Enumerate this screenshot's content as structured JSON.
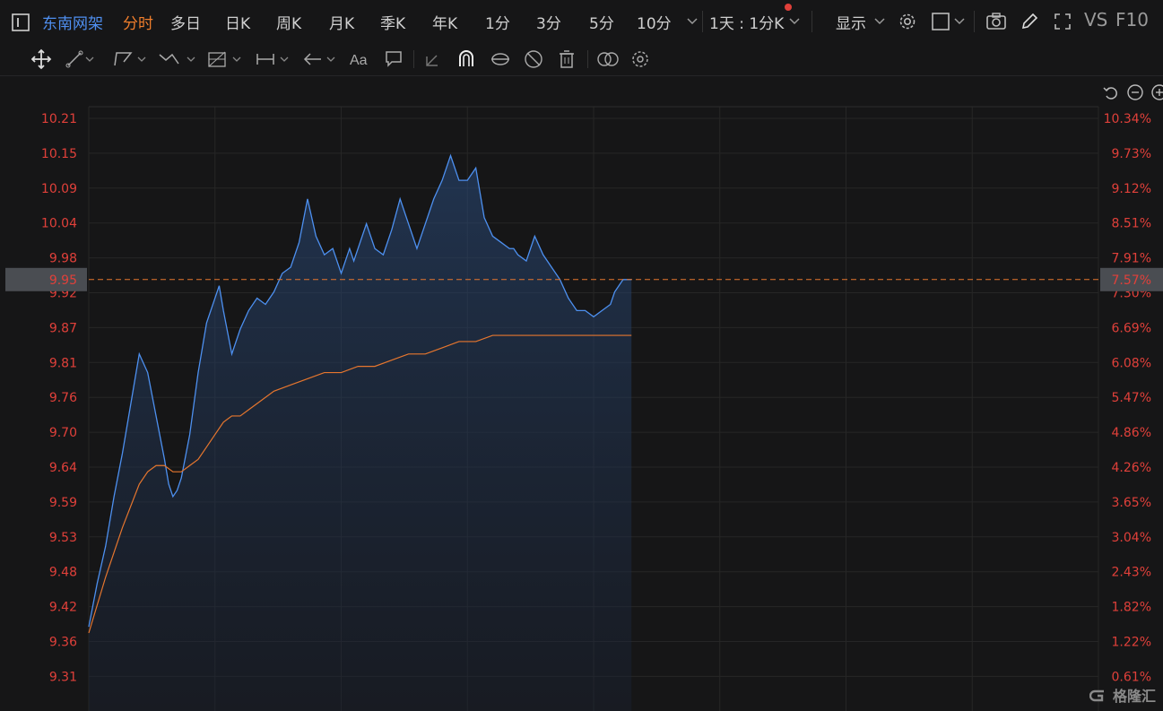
{
  "header": {
    "stock_name": "东南网架",
    "tabs": [
      {
        "label": "分时",
        "active": true
      },
      {
        "label": "多日"
      },
      {
        "label": "日K"
      },
      {
        "label": "周K"
      },
      {
        "label": "月K"
      },
      {
        "label": "季K"
      },
      {
        "label": "年K"
      },
      {
        "label": "1分"
      },
      {
        "label": "3分"
      },
      {
        "label": "5分"
      },
      {
        "label": "10分"
      }
    ],
    "period_select": "1天 : 1分K",
    "display_label": "显示",
    "vs_label": "VS",
    "f10_label": "F10"
  },
  "colors": {
    "price_line": "#4d90f0",
    "avg_line": "#e6762e",
    "axis_text": "#e0403a",
    "grid": "#262626",
    "crosshair": "#e6762e",
    "active_tab": "#f07e2c"
  },
  "chart_data": {
    "type": "line",
    "left_ticks": [
      "10.21",
      "10.15",
      "10.09",
      "10.04",
      "9.98",
      "9.92",
      "9.87",
      "9.81",
      "9.76",
      "9.70",
      "9.64",
      "9.59",
      "9.53",
      "9.48",
      "9.42",
      "9.36",
      "9.31"
    ],
    "right_ticks": [
      "10.34%",
      "9.73%",
      "9.12%",
      "8.51%",
      "7.91%",
      "7.30%",
      "6.69%",
      "6.08%",
      "5.47%",
      "4.86%",
      "4.26%",
      "3.65%",
      "3.04%",
      "2.43%",
      "1.82%",
      "1.22%",
      "0.61%"
    ],
    "crosshair_price": "9.95",
    "crosshair_pct": "7.57%",
    "ylim": [
      9.31,
      10.21
    ],
    "x_sessions": 240,
    "series": [
      {
        "key": "price",
        "x": [
          0,
          2,
          4,
          6,
          8,
          10,
          12,
          14,
          16,
          18,
          19,
          20,
          21,
          22,
          24,
          26,
          28,
          30,
          31,
          32,
          34,
          36,
          38,
          40,
          42,
          44,
          46,
          48,
          50,
          52,
          54,
          56,
          58,
          60,
          62,
          63,
          64,
          66,
          68,
          70,
          72,
          74,
          76,
          78,
          80,
          82,
          84,
          86,
          88,
          90,
          92,
          94,
          96,
          98,
          100,
          101,
          102,
          104,
          106,
          108,
          110,
          112,
          114,
          116,
          118,
          120,
          122,
          124,
          125,
          126,
          127,
          128,
          129
        ],
        "values": [
          9.39,
          9.46,
          9.52,
          9.6,
          9.67,
          9.75,
          9.83,
          9.8,
          9.73,
          9.66,
          9.62,
          9.6,
          9.61,
          9.63,
          9.7,
          9.8,
          9.88,
          9.92,
          9.94,
          9.9,
          9.83,
          9.87,
          9.9,
          9.92,
          9.91,
          9.93,
          9.96,
          9.97,
          10.01,
          10.08,
          10.02,
          9.99,
          10.0,
          9.96,
          10.0,
          9.98,
          10.0,
          10.04,
          10.0,
          9.99,
          10.03,
          10.08,
          10.04,
          10.0,
          10.04,
          10.08,
          10.11,
          10.15,
          10.11,
          10.11,
          10.13,
          10.05,
          10.02,
          10.01,
          10.0,
          10.0,
          9.99,
          9.98,
          10.02,
          9.99,
          9.97,
          9.95,
          9.92,
          9.9,
          9.9,
          9.89,
          9.9,
          9.91,
          9.93,
          9.94,
          9.95,
          9.95,
          9.95
        ]
      },
      {
        "key": "avg",
        "x": [
          0,
          4,
          8,
          12,
          14,
          16,
          18,
          20,
          22,
          24,
          26,
          28,
          30,
          32,
          34,
          36,
          38,
          40,
          44,
          48,
          52,
          56,
          60,
          64,
          68,
          72,
          76,
          80,
          84,
          88,
          92,
          96,
          100,
          104,
          108,
          112,
          116,
          120,
          124,
          129
        ],
        "values": [
          9.38,
          9.47,
          9.55,
          9.62,
          9.64,
          9.65,
          9.65,
          9.64,
          9.64,
          9.65,
          9.66,
          9.68,
          9.7,
          9.72,
          9.73,
          9.73,
          9.74,
          9.75,
          9.77,
          9.78,
          9.79,
          9.8,
          9.8,
          9.81,
          9.81,
          9.82,
          9.83,
          9.83,
          9.84,
          9.85,
          9.85,
          9.86,
          9.86,
          9.86,
          9.86,
          9.86,
          9.86,
          9.86,
          9.86,
          9.86
        ]
      }
    ]
  }
}
